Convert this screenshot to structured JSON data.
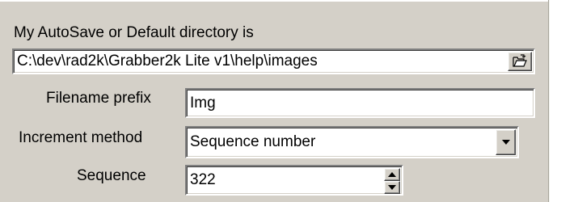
{
  "directory": {
    "label": "My AutoSave or Default directory is",
    "path": "C:\\dev\\rad2k\\Grabber2k Lite v1\\help\\images",
    "browse_icon": "open-folder-icon"
  },
  "filename_prefix": {
    "label": "Filename prefix",
    "value": "Img"
  },
  "increment_method": {
    "label": "Increment method",
    "selected": "Sequence number",
    "dropdown_icon": "chevron-down-icon"
  },
  "sequence": {
    "label": "Sequence",
    "value": "322",
    "up_icon": "spin-up-icon",
    "down_icon": "spin-down-icon"
  }
}
